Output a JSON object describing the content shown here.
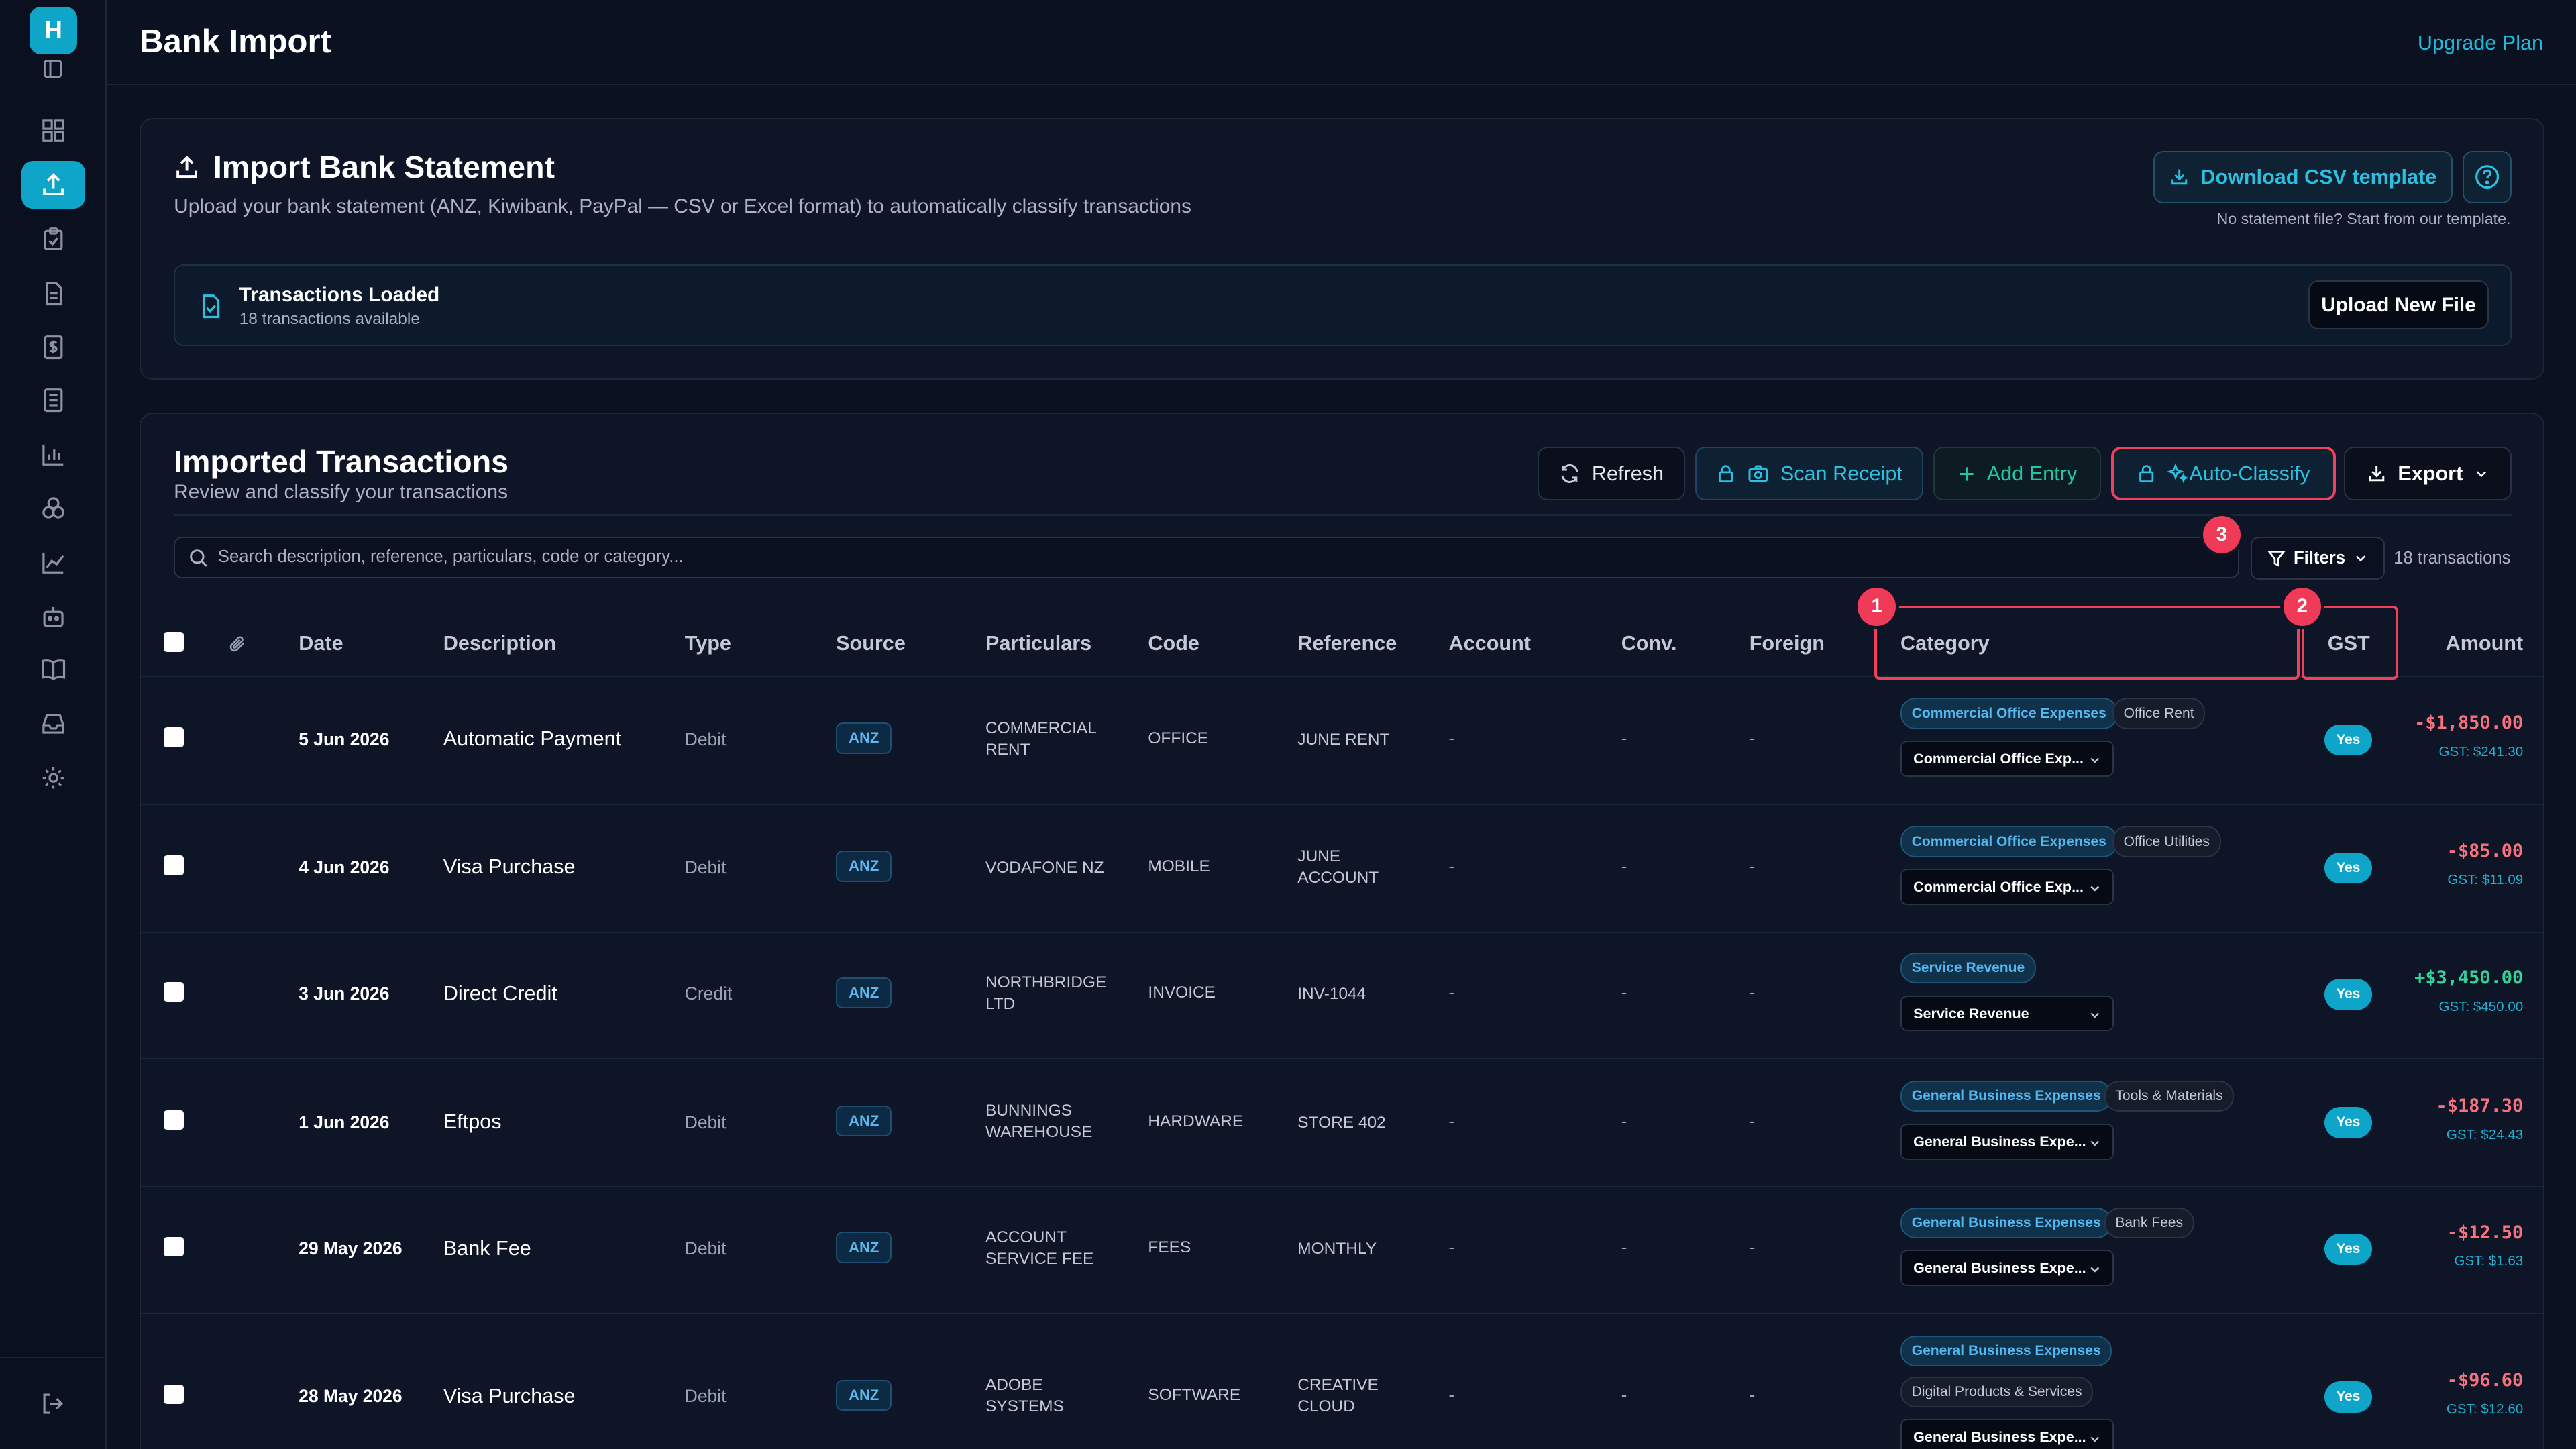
{
  "app": {
    "logo_letter": "H"
  },
  "header": {
    "title": "Bank Import",
    "upgrade": "Upgrade Plan"
  },
  "import": {
    "title": "Import Bank Statement",
    "subtitle": "Upload your bank statement (ANZ, Kiwibank, PayPal — CSV or Excel format) to automatically classify transactions",
    "download_label": "Download CSV template",
    "csv_note": "No statement file? Start from our template.",
    "loaded_title": "Transactions Loaded",
    "loaded_sub": "18 transactions available",
    "upload_label": "Upload New File"
  },
  "transactions": {
    "title": "Imported Transactions",
    "subtitle": "Review and classify your transactions",
    "toolbar": {
      "refresh": "Refresh",
      "scan": "Scan Receipt",
      "add": "Add Entry",
      "auto": "Auto-Classify",
      "export": "Export"
    },
    "search_placeholder": "Search description, reference, particulars, code or category...",
    "filters": "Filters",
    "count": "18 transactions",
    "badges": [
      "1",
      "2",
      "3"
    ],
    "columns": {
      "date": "Date",
      "description": "Description",
      "type": "Type",
      "source": "Source",
      "particulars": "Particulars",
      "code": "Code",
      "reference": "Reference",
      "account": "Account",
      "conv": "Conv.",
      "foreign": "Foreign",
      "category": "Category",
      "gst": "GST",
      "amount": "Amount"
    },
    "rows": [
      {
        "date": "5 Jun 2026",
        "description": "Automatic Payment",
        "type": "Debit",
        "source": "ANZ",
        "particulars": "COMMERCIAL RENT",
        "code": "OFFICE",
        "reference": "JUNE RENT",
        "account": "-",
        "conv": "-",
        "foreign": "-",
        "tag": "Commercial Office Expenses",
        "subtag": "Office Rent",
        "select": "Commercial Office Exp...",
        "gst": "Yes",
        "amount": "-$1,850.00",
        "gst_amount": "GST: $241.30",
        "direction": "neg"
      },
      {
        "date": "4 Jun 2026",
        "description": "Visa Purchase",
        "type": "Debit",
        "source": "ANZ",
        "particulars": "VODAFONE NZ",
        "code": "MOBILE",
        "reference": "JUNE ACCOUNT",
        "account": "-",
        "conv": "-",
        "foreign": "-",
        "tag": "Commercial Office Expenses",
        "subtag": "Office Utilities",
        "select": "Commercial Office Exp...",
        "gst": "Yes",
        "amount": "-$85.00",
        "gst_amount": "GST: $11.09",
        "direction": "neg"
      },
      {
        "date": "3 Jun 2026",
        "description": "Direct Credit",
        "type": "Credit",
        "source": "ANZ",
        "particulars": "NORTHBRIDGE LTD",
        "code": "INVOICE",
        "reference": "INV-1044",
        "account": "-",
        "conv": "-",
        "foreign": "-",
        "tag": "Service Revenue",
        "subtag": "",
        "select": "Service Revenue",
        "gst": "Yes",
        "amount": "+$3,450.00",
        "gst_amount": "GST: $450.00",
        "direction": "pos"
      },
      {
        "date": "1 Jun 2026",
        "description": "Eftpos",
        "type": "Debit",
        "source": "ANZ",
        "particulars": "BUNNINGS WAREHOUSE",
        "code": "HARDWARE",
        "reference": "STORE 402",
        "account": "-",
        "conv": "-",
        "foreign": "-",
        "tag": "General Business Expenses",
        "subtag": "Tools & Materials",
        "select": "General Business Expe...",
        "gst": "Yes",
        "amount": "-$187.30",
        "gst_amount": "GST: $24.43",
        "direction": "neg"
      },
      {
        "date": "29 May 2026",
        "description": "Bank Fee",
        "type": "Debit",
        "source": "ANZ",
        "particulars": "ACCOUNT SERVICE FEE",
        "code": "FEES",
        "reference": "MONTHLY",
        "account": "-",
        "conv": "-",
        "foreign": "-",
        "tag": "General Business Expenses",
        "subtag": "Bank Fees",
        "select": "General Business Expe...",
        "gst": "Yes",
        "amount": "-$12.50",
        "gst_amount": "GST: $1.63",
        "direction": "neg"
      },
      {
        "date": "28 May 2026",
        "description": "Visa Purchase",
        "type": "Debit",
        "source": "ANZ",
        "particulars": "ADOBE SYSTEMS",
        "code": "SOFTWARE",
        "reference": "CREATIVE CLOUD",
        "account": "-",
        "conv": "-",
        "foreign": "-",
        "tag": "General Business Expenses",
        "subtag": "Digital Products & Services",
        "select": "General Business Expe...",
        "gst": "Yes",
        "amount": "-$96.60",
        "gst_amount": "GST: $12.60",
        "direction": "neg"
      }
    ]
  }
}
